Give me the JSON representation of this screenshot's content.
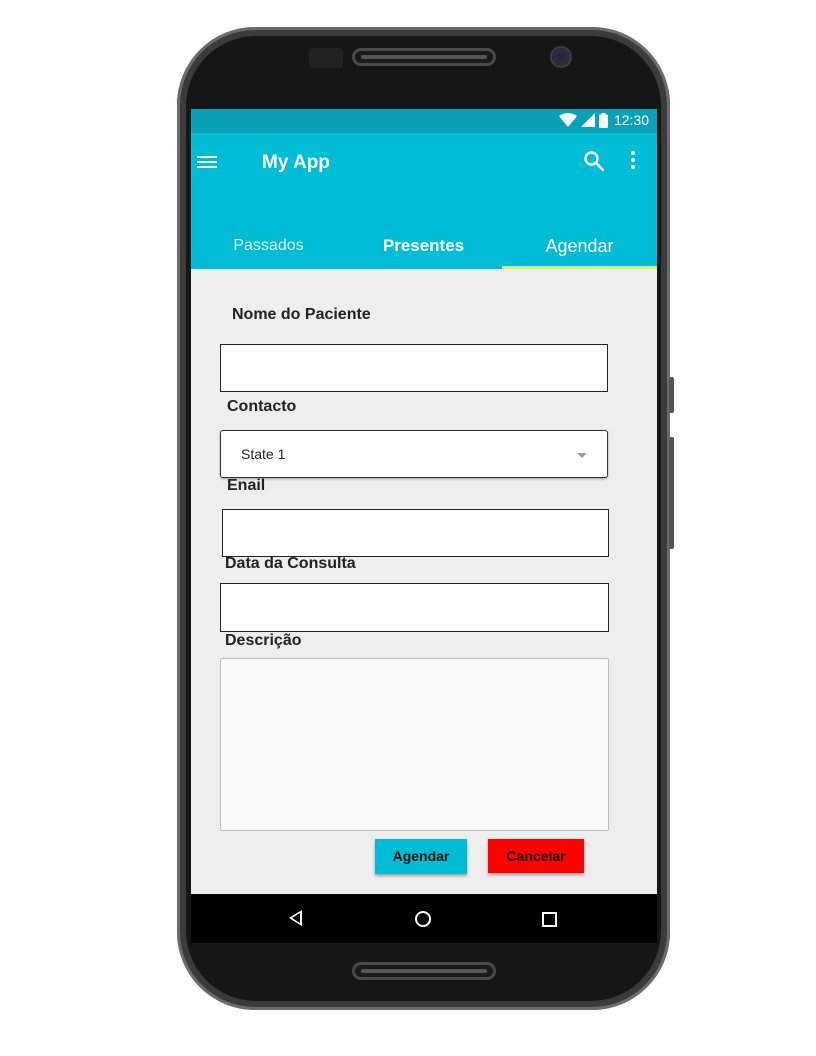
{
  "status_bar": {
    "time": "12:30",
    "icons": [
      "wifi-icon",
      "signal-icon",
      "battery-icon"
    ]
  },
  "app_bar": {
    "title": "My App",
    "icons": [
      "menu-icon",
      "search-icon",
      "more-vert-icon"
    ]
  },
  "tabs": [
    {
      "label": "Passados"
    },
    {
      "label": "Presentes"
    },
    {
      "label": "Agendar"
    }
  ],
  "selected_tab": "Agendar",
  "form": {
    "patient_name_label": "Nome do Paciente",
    "patient_name_value": "",
    "contact_label": "Contacto",
    "contact_value": "State 1",
    "email_label": "Enail",
    "email_value": "",
    "date_label": "Data da Consulta",
    "date_value": "",
    "description_label": "Descrição",
    "description_value": ""
  },
  "buttons": {
    "schedule": "Agendar",
    "cancel": "Cancelar"
  },
  "colors": {
    "primary": "#00bcd4",
    "status_bar": "#0aa1b6",
    "tab_indicator": "#d5f07a",
    "cancel": "#ff0000",
    "background": "#eeeeee"
  }
}
